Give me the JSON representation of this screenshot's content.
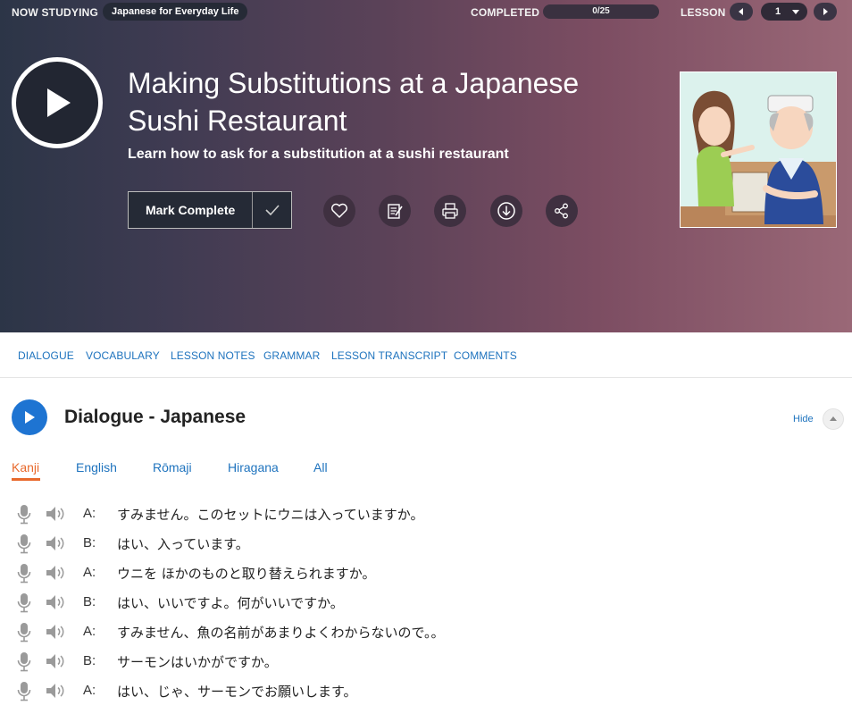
{
  "topbar": {
    "now_studying_label": "NOW STUDYING",
    "course_name": "Japanese for Everyday Life",
    "completed_label": "COMPLETED",
    "progress_text": "0/25",
    "progress_fraction": 0,
    "lesson_label": "LESSON",
    "lesson_number": "1"
  },
  "hero": {
    "title": "Making Substitutions at a Japanese Sushi Restaurant",
    "subtitle": "Learn how to ask for a substitution at a sushi restaurant",
    "mark_complete_label": "Mark Complete",
    "actions": [
      "heart-icon",
      "notes-icon",
      "print-icon",
      "download-icon",
      "share-icon"
    ]
  },
  "tabs": [
    "DIALOGUE",
    "VOCABULARY",
    "LESSON NOTES",
    "GRAMMAR",
    "LESSON TRANSCRIPT",
    "COMMENTS"
  ],
  "dialogue": {
    "title": "Dialogue - Japanese",
    "hide_label": "Hide",
    "modes": [
      "Kanji",
      "English",
      "Rōmaji",
      "Hiragana",
      "All"
    ],
    "active_mode": "Kanji",
    "lines": [
      {
        "speaker": "A:",
        "text": "すみません。このセットにウニは入っていますか。"
      },
      {
        "speaker": "B:",
        "text": "はい、入っています。"
      },
      {
        "speaker": "A:",
        "text": "ウニを ほかのものと取り替えられますか。"
      },
      {
        "speaker": "B:",
        "text": "はい、いいですよ。何がいいですか。"
      },
      {
        "speaker": "A:",
        "text": "すみません、魚の名前があまりよくわからないので。。"
      },
      {
        "speaker": "B:",
        "text": "サーモンはいかがですか。"
      },
      {
        "speaker": "A:",
        "text": "はい、じゃ、サーモンでお願いします。"
      }
    ]
  },
  "colors": {
    "accent_blue": "#1e73be",
    "active_tab_orange": "#e8692c",
    "play_blue": "#1e74d2"
  }
}
